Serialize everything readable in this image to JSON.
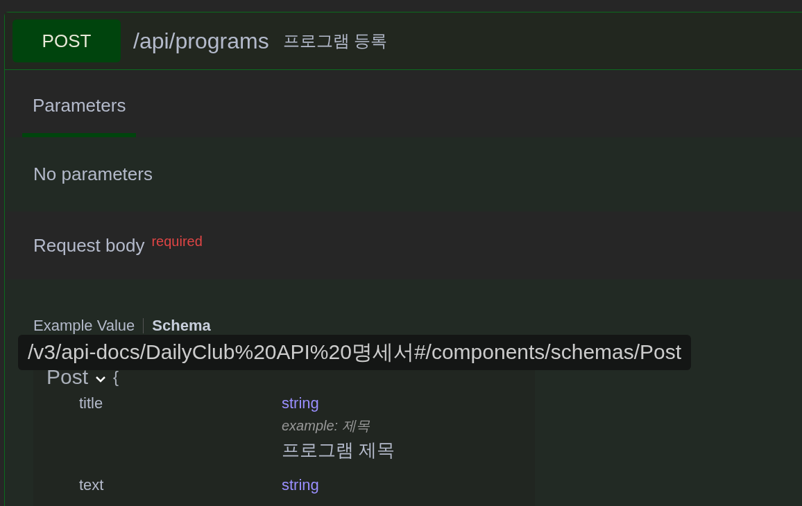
{
  "operation": {
    "method": "POST",
    "path": "/api/programs",
    "summary": "프로그램 등록"
  },
  "tabs": [
    {
      "label": "Parameters",
      "selected": true
    }
  ],
  "parameters_message": "No parameters",
  "request_body": {
    "label": "Request body",
    "required_label": "required"
  },
  "body_tabs": [
    {
      "label": "Example Value",
      "selected": false
    },
    {
      "label": "Schema",
      "selected": true
    }
  ],
  "tooltip": "/v3/api-docs/DailyClub%20API%20명세서#/components/schemas/Post",
  "model": {
    "name": "Post",
    "expanded": true,
    "open_brace": "{",
    "properties": [
      {
        "name": "title",
        "type": "string",
        "example": "example: 제목",
        "description": "프로그램 제목"
      },
      {
        "name": "text",
        "type": "string"
      }
    ]
  }
}
